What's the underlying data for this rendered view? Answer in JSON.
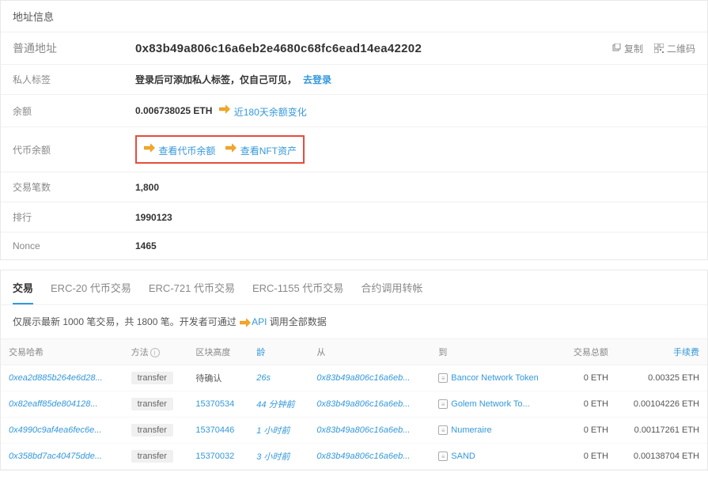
{
  "header": {
    "title": "地址信息"
  },
  "address_row": {
    "label": "普通地址",
    "value": "0x83b49a806c16a6eb2e4680c68fc6ead14ea42202",
    "copy_label": "复制",
    "qr_label": "二维码"
  },
  "rows": {
    "private_tag": {
      "label": "私人标签",
      "prefix": "登录后可添加私人标签，仅自己可见，",
      "login_link": "去登录"
    },
    "balance": {
      "label": "余额",
      "value": "0.006738025 ETH",
      "link": "近180天余额变化"
    },
    "token_balance": {
      "label": "代币余额",
      "link1": "查看代币余额",
      "link2": "查看NFT资产"
    },
    "tx_count": {
      "label": "交易笔数",
      "value": "1,800"
    },
    "rank": {
      "label": "排行",
      "value": "1990123"
    },
    "nonce": {
      "label": "Nonce",
      "value": "1465"
    }
  },
  "tabs": [
    "交易",
    "ERC-20 代币交易",
    "ERC-721 代币交易",
    "ERC-1155 代币交易",
    "合约调用转帐"
  ],
  "note": {
    "prefix": "仅展示最新 1000 笔交易，共 1800 笔。开发者可通过 ",
    "link": "API",
    "suffix": " 调用全部数据"
  },
  "columns": {
    "hash": "交易哈希",
    "method": "方法",
    "block": "区块高度",
    "age": "龄",
    "from": "从",
    "to": "到",
    "amount": "交易总额",
    "fee": "手续费"
  },
  "tx": [
    {
      "hash": "0xea2d885b264e6d28...",
      "method": "transfer",
      "block": "待确认",
      "block_pending": true,
      "age": "26s",
      "from": "0x83b49a806c16a6eb...",
      "to": "Bancor Network Token",
      "amount": "0 ETH",
      "fee": "0.00325 ETH"
    },
    {
      "hash": "0x82eaff85de804128...",
      "method": "transfer",
      "block": "15370534",
      "age": "44 分钟前",
      "from": "0x83b49a806c16a6eb...",
      "to": "Golem Network To...",
      "amount": "0 ETH",
      "fee": "0.00104226 ETH"
    },
    {
      "hash": "0x4990c9af4ea6fec6e...",
      "method": "transfer",
      "block": "15370446",
      "age": "1 小时前",
      "from": "0x83b49a806c16a6eb...",
      "to": "Numeraire",
      "amount": "0 ETH",
      "fee": "0.00117261 ETH"
    },
    {
      "hash": "0x358bd7ac40475dde...",
      "method": "transfer",
      "block": "15370032",
      "age": "3 小时前",
      "from": "0x83b49a806c16a6eb...",
      "to": "SAND",
      "amount": "0 ETH",
      "fee": "0.00138704 ETH"
    }
  ]
}
